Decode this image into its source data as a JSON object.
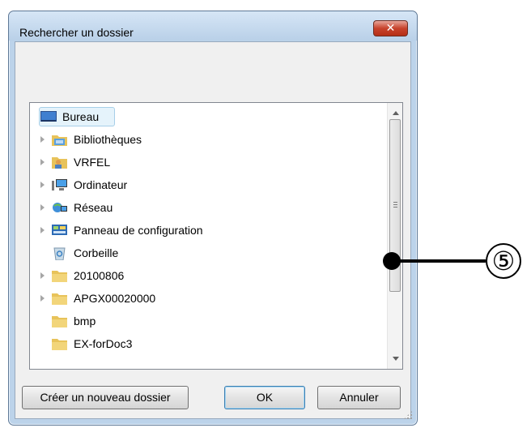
{
  "dialog": {
    "title": "Rechercher un dossier",
    "close_glyph": "✕"
  },
  "tree": {
    "items": [
      {
        "label": "Bureau",
        "icon": "desktop-icon",
        "expandable": false,
        "selected": true
      },
      {
        "label": "Bibliothèques",
        "icon": "libraries-icon",
        "expandable": true
      },
      {
        "label": "VRFEL",
        "icon": "user-folder-icon",
        "expandable": true
      },
      {
        "label": "Ordinateur",
        "icon": "computer-icon",
        "expandable": true
      },
      {
        "label": "Réseau",
        "icon": "network-icon",
        "expandable": true
      },
      {
        "label": "Panneau de configuration",
        "icon": "control-panel-icon",
        "expandable": true
      },
      {
        "label": "Corbeille",
        "icon": "recycle-bin-icon",
        "expandable": false
      },
      {
        "label": "20100806",
        "icon": "folder-icon",
        "expandable": true
      },
      {
        "label": "APGX00020000",
        "icon": "folder-icon",
        "expandable": true
      },
      {
        "label": "bmp",
        "icon": "folder-icon",
        "expandable": false
      },
      {
        "label": "EX-forDoc3",
        "icon": "folder-icon",
        "expandable": false
      }
    ]
  },
  "buttons": {
    "new_folder": "Créer un nouveau dossier",
    "ok": "OK",
    "cancel": "Annuler"
  },
  "callout": {
    "number": "⑤"
  },
  "colors": {
    "window_frame": "#bcd3ea",
    "close_button": "#c7422c",
    "selection": "#e5f3fb",
    "folder": "#e8c35a"
  }
}
